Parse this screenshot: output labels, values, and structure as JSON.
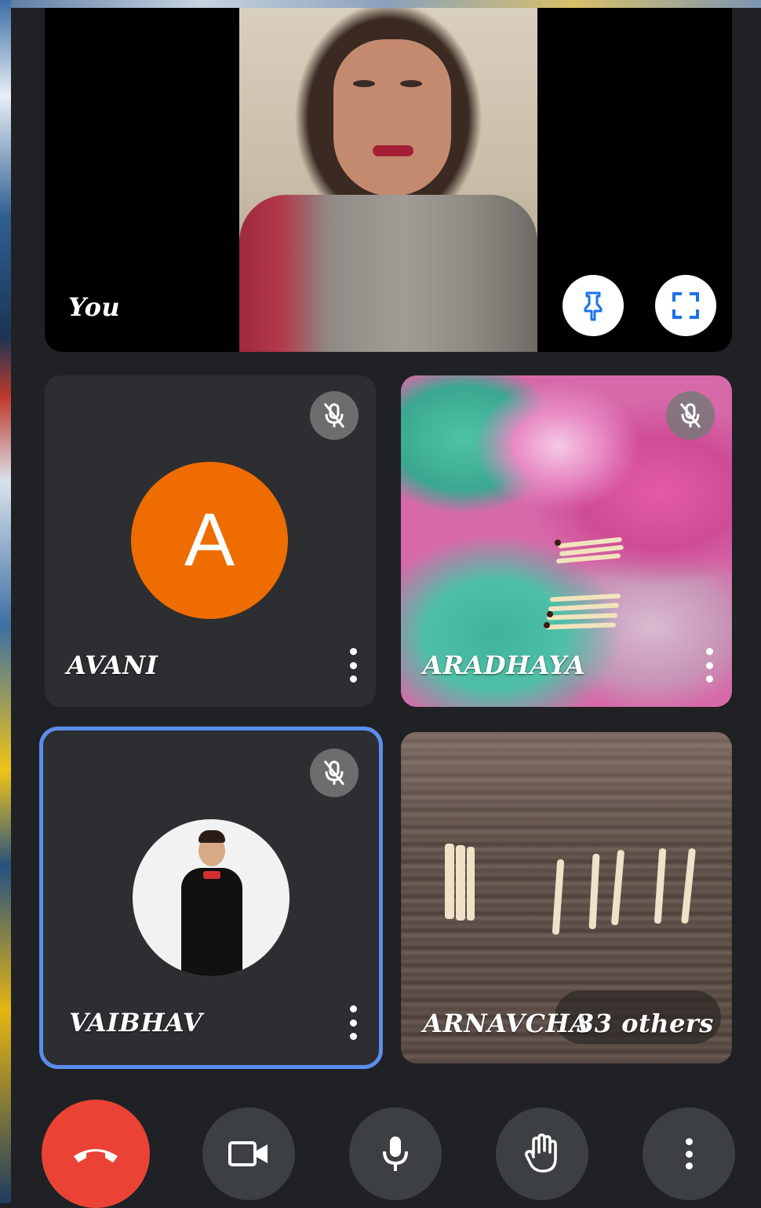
{
  "participants": {
    "self": {
      "name": "You"
    },
    "avani": {
      "name": "AVANI",
      "avatar_letter": "A",
      "avatar_color": "#ef6c00",
      "muted": true
    },
    "aradhaya": {
      "name": "ARADHAYA",
      "muted": true
    },
    "vaibhav": {
      "name": "VAIBHAV",
      "muted": true,
      "selected": true
    },
    "arnav": {
      "name": "ARNAVCHA",
      "others_label": "33 others"
    }
  },
  "controls": {
    "items": [
      "end-call",
      "camera",
      "microphone",
      "raise-hand",
      "more-options"
    ],
    "end_call_color": "#ea4335"
  },
  "colors": {
    "background": "#202124",
    "tile": "#2d2e31",
    "highlight": "#5a8dee"
  }
}
